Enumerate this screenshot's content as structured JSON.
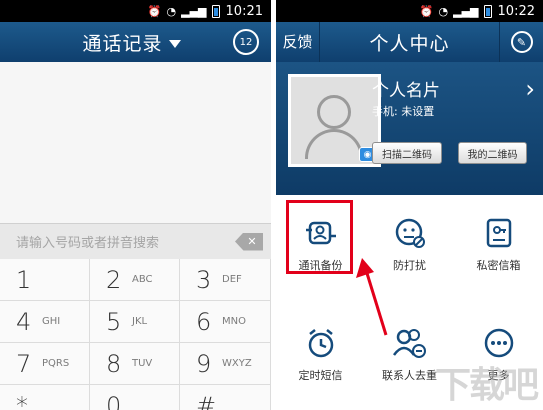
{
  "left_phone": {
    "status": {
      "time": "10:21"
    },
    "header": {
      "title": "通话记录",
      "dial_badge": "12"
    },
    "input": {
      "placeholder": "请输入号码或者拼音搜索"
    },
    "keypad": [
      {
        "num": "1",
        "letters": ""
      },
      {
        "num": "2",
        "letters": "ABC"
      },
      {
        "num": "3",
        "letters": "DEF"
      },
      {
        "num": "4",
        "letters": "GHI"
      },
      {
        "num": "5",
        "letters": "JKL"
      },
      {
        "num": "6",
        "letters": "MNO"
      },
      {
        "num": "7",
        "letters": "PQRS"
      },
      {
        "num": "8",
        "letters": "TUV"
      },
      {
        "num": "9",
        "letters": "WXYZ"
      },
      {
        "num": "*",
        "letters": ""
      },
      {
        "num": "0",
        "letters": ""
      },
      {
        "num": "#",
        "letters": ""
      }
    ]
  },
  "right_phone": {
    "status": {
      "time": "10:22"
    },
    "header": {
      "left": "反馈",
      "title": "个人中心"
    },
    "card": {
      "name": "个人名片",
      "phone": "手机: 未设置",
      "scan_label": "扫描二维码",
      "myqr_label": "我的二维码"
    },
    "grid": [
      {
        "label": "通讯备份",
        "icon": "contacts-backup-icon"
      },
      {
        "label": "防打扰",
        "icon": "do-not-disturb-icon"
      },
      {
        "label": "私密信箱",
        "icon": "private-mailbox-icon"
      },
      {
        "label": "定时短信",
        "icon": "scheduled-sms-icon"
      },
      {
        "label": "联系人去重",
        "icon": "contact-dedupe-icon"
      },
      {
        "label": "更多",
        "icon": "more-icon"
      }
    ]
  },
  "colors": {
    "header": "#154b7c",
    "accent": "#2f8de0",
    "highlight": "#e2001a"
  }
}
